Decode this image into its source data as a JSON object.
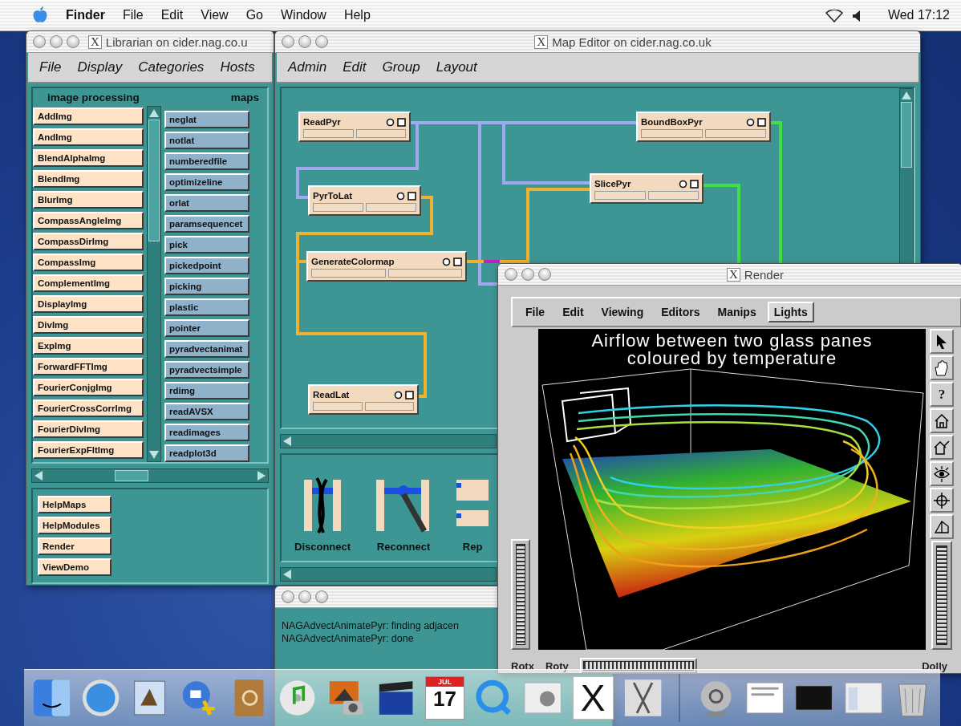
{
  "menubar": {
    "app": "Finder",
    "items": [
      "File",
      "Edit",
      "View",
      "Go",
      "Window",
      "Help"
    ],
    "clock": "Wed 17:12"
  },
  "librarian": {
    "title_icon": "X",
    "title": "Librarian on cider.nag.co.u",
    "menu": [
      "File",
      "Display",
      "Categories",
      "Hosts"
    ],
    "categories": [
      "image processing",
      "maps"
    ],
    "modules": [
      "AddImg",
      "AndImg",
      "BlendAlphaImg",
      "BlendImg",
      "BlurImg",
      "CompassAngleImg",
      "CompassDirImg",
      "CompassImg",
      "ComplementImg",
      "DisplayImg",
      "DivImg",
      "ExpImg",
      "ForwardFFTImg",
      "FourierConjgImg",
      "FourierCrossCorrImg",
      "FourierDivImg",
      "FourierExpFltImg"
    ],
    "maps": [
      "neglat",
      "notlat",
      "numberedfile",
      "optimizeline",
      "orlat",
      "paramsequencet",
      "pick",
      "pickedpoint",
      "picking",
      "plastic",
      "pointer",
      "pyradvectanimat",
      "pyradvectsimple",
      "rdimg",
      "readAVSX",
      "readimages",
      "readplot3d"
    ],
    "help_buttons": [
      "HelpMaps",
      "HelpModules",
      "Render",
      "ViewDemo"
    ]
  },
  "map_editor": {
    "title_icon": "X",
    "title": "Map Editor on cider.nag.co.uk",
    "menu": [
      "Admin",
      "Edit",
      "Group",
      "Layout"
    ],
    "nodes": [
      "ReadPyr",
      "BoundBoxPyr",
      "PyrToLat",
      "SlicePyr",
      "GenerateColormap",
      "ReadLat"
    ],
    "tools": [
      {
        "kind": "disconnect",
        "label": "Disconnect"
      },
      {
        "kind": "reconnect",
        "label": "Reconnect"
      },
      {
        "kind": "replace",
        "label": "Rep"
      }
    ]
  },
  "log": {
    "lines": [
      "NAGAdvectAnimatePyr: finding adjacen",
      "NAGAdvectAnimatePyr: done"
    ]
  },
  "render": {
    "title_icon": "X",
    "title": "Render",
    "menu": [
      {
        "label": "File",
        "selected": false
      },
      {
        "label": "Edit",
        "selected": false
      },
      {
        "label": "Viewing",
        "selected": false
      },
      {
        "label": "Editors",
        "selected": false
      },
      {
        "label": "Manips",
        "selected": false
      },
      {
        "label": "Lights",
        "selected": true
      }
    ],
    "caption": [
      "Airflow between two glass panes",
      "coloured by temperature"
    ],
    "help_glyph": "?",
    "wheels": [
      "Rotx",
      "Roty",
      "Dolly"
    ]
  },
  "dock": {
    "calendar_month": "JUL",
    "calendar_day": "17",
    "x11_letter": "X"
  }
}
